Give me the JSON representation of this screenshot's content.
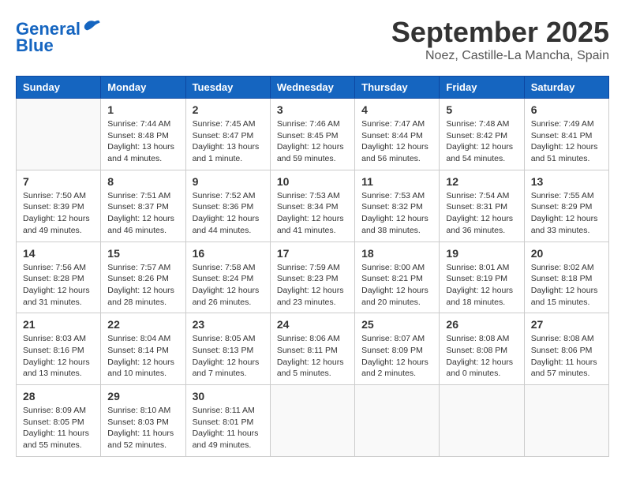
{
  "header": {
    "logo_line1": "General",
    "logo_line2": "Blue",
    "month": "September 2025",
    "location": "Noez, Castille-La Mancha, Spain"
  },
  "days_of_week": [
    "Sunday",
    "Monday",
    "Tuesday",
    "Wednesday",
    "Thursday",
    "Friday",
    "Saturday"
  ],
  "weeks": [
    [
      {
        "day": "",
        "info": ""
      },
      {
        "day": "1",
        "info": "Sunrise: 7:44 AM\nSunset: 8:48 PM\nDaylight: 13 hours\nand 4 minutes."
      },
      {
        "day": "2",
        "info": "Sunrise: 7:45 AM\nSunset: 8:47 PM\nDaylight: 13 hours\nand 1 minute."
      },
      {
        "day": "3",
        "info": "Sunrise: 7:46 AM\nSunset: 8:45 PM\nDaylight: 12 hours\nand 59 minutes."
      },
      {
        "day": "4",
        "info": "Sunrise: 7:47 AM\nSunset: 8:44 PM\nDaylight: 12 hours\nand 56 minutes."
      },
      {
        "day": "5",
        "info": "Sunrise: 7:48 AM\nSunset: 8:42 PM\nDaylight: 12 hours\nand 54 minutes."
      },
      {
        "day": "6",
        "info": "Sunrise: 7:49 AM\nSunset: 8:41 PM\nDaylight: 12 hours\nand 51 minutes."
      }
    ],
    [
      {
        "day": "7",
        "info": "Sunrise: 7:50 AM\nSunset: 8:39 PM\nDaylight: 12 hours\nand 49 minutes."
      },
      {
        "day": "8",
        "info": "Sunrise: 7:51 AM\nSunset: 8:37 PM\nDaylight: 12 hours\nand 46 minutes."
      },
      {
        "day": "9",
        "info": "Sunrise: 7:52 AM\nSunset: 8:36 PM\nDaylight: 12 hours\nand 44 minutes."
      },
      {
        "day": "10",
        "info": "Sunrise: 7:53 AM\nSunset: 8:34 PM\nDaylight: 12 hours\nand 41 minutes."
      },
      {
        "day": "11",
        "info": "Sunrise: 7:53 AM\nSunset: 8:32 PM\nDaylight: 12 hours\nand 38 minutes."
      },
      {
        "day": "12",
        "info": "Sunrise: 7:54 AM\nSunset: 8:31 PM\nDaylight: 12 hours\nand 36 minutes."
      },
      {
        "day": "13",
        "info": "Sunrise: 7:55 AM\nSunset: 8:29 PM\nDaylight: 12 hours\nand 33 minutes."
      }
    ],
    [
      {
        "day": "14",
        "info": "Sunrise: 7:56 AM\nSunset: 8:28 PM\nDaylight: 12 hours\nand 31 minutes."
      },
      {
        "day": "15",
        "info": "Sunrise: 7:57 AM\nSunset: 8:26 PM\nDaylight: 12 hours\nand 28 minutes."
      },
      {
        "day": "16",
        "info": "Sunrise: 7:58 AM\nSunset: 8:24 PM\nDaylight: 12 hours\nand 26 minutes."
      },
      {
        "day": "17",
        "info": "Sunrise: 7:59 AM\nSunset: 8:23 PM\nDaylight: 12 hours\nand 23 minutes."
      },
      {
        "day": "18",
        "info": "Sunrise: 8:00 AM\nSunset: 8:21 PM\nDaylight: 12 hours\nand 20 minutes."
      },
      {
        "day": "19",
        "info": "Sunrise: 8:01 AM\nSunset: 8:19 PM\nDaylight: 12 hours\nand 18 minutes."
      },
      {
        "day": "20",
        "info": "Sunrise: 8:02 AM\nSunset: 8:18 PM\nDaylight: 12 hours\nand 15 minutes."
      }
    ],
    [
      {
        "day": "21",
        "info": "Sunrise: 8:03 AM\nSunset: 8:16 PM\nDaylight: 12 hours\nand 13 minutes."
      },
      {
        "day": "22",
        "info": "Sunrise: 8:04 AM\nSunset: 8:14 PM\nDaylight: 12 hours\nand 10 minutes."
      },
      {
        "day": "23",
        "info": "Sunrise: 8:05 AM\nSunset: 8:13 PM\nDaylight: 12 hours\nand 7 minutes."
      },
      {
        "day": "24",
        "info": "Sunrise: 8:06 AM\nSunset: 8:11 PM\nDaylight: 12 hours\nand 5 minutes."
      },
      {
        "day": "25",
        "info": "Sunrise: 8:07 AM\nSunset: 8:09 PM\nDaylight: 12 hours\nand 2 minutes."
      },
      {
        "day": "26",
        "info": "Sunrise: 8:08 AM\nSunset: 8:08 PM\nDaylight: 12 hours\nand 0 minutes."
      },
      {
        "day": "27",
        "info": "Sunrise: 8:08 AM\nSunset: 8:06 PM\nDaylight: 11 hours\nand 57 minutes."
      }
    ],
    [
      {
        "day": "28",
        "info": "Sunrise: 8:09 AM\nSunset: 8:05 PM\nDaylight: 11 hours\nand 55 minutes."
      },
      {
        "day": "29",
        "info": "Sunrise: 8:10 AM\nSunset: 8:03 PM\nDaylight: 11 hours\nand 52 minutes."
      },
      {
        "day": "30",
        "info": "Sunrise: 8:11 AM\nSunset: 8:01 PM\nDaylight: 11 hours\nand 49 minutes."
      },
      {
        "day": "",
        "info": ""
      },
      {
        "day": "",
        "info": ""
      },
      {
        "day": "",
        "info": ""
      },
      {
        "day": "",
        "info": ""
      }
    ]
  ]
}
